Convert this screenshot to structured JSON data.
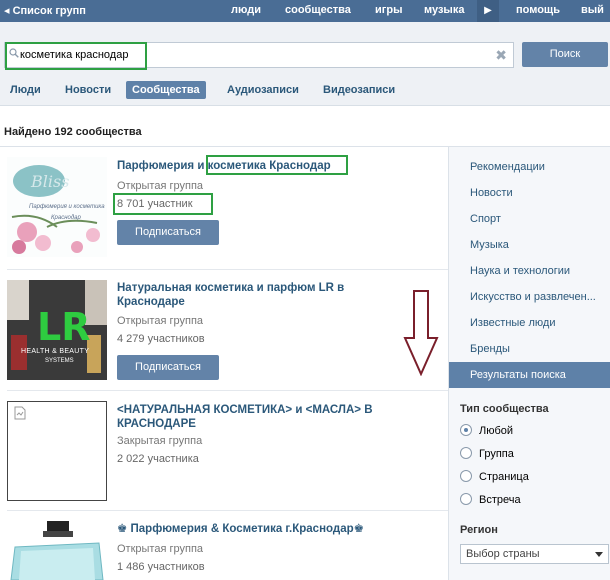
{
  "topbar": {
    "back_label": "◂ Список групп",
    "nav": [
      "люди",
      "сообщества",
      "игры",
      "музыка",
      "помощь",
      "вый"
    ]
  },
  "search": {
    "query": "косметика краснодар",
    "button_label": "Поиск"
  },
  "tabs": [
    "Люди",
    "Новости",
    "Сообщества",
    "Аудиозаписи",
    "Видеозаписи"
  ],
  "active_tab": "Сообщества",
  "results": {
    "found_label": "Найдено 192 сообщества",
    "items": [
      {
        "title_a": "Парфюмерия и ",
        "title_b": "косметика Краснодар",
        "type": "Открытая группа",
        "members": "8 701 участник",
        "button": "Подписаться",
        "thumb_text": "Парфюмерия и косметика",
        "thumb_subtext": "Краснодар"
      },
      {
        "title": "Натуральная косметика и парфюм LR в Краснодаре",
        "type": "Открытая группа",
        "members": "4 279 участников",
        "button": "Подписаться",
        "thumb_logo": "LR",
        "thumb_text": "HEALTH & BEAUTY",
        "thumb_subtext": "SYSTEMS"
      },
      {
        "title": "<НАТУРАЛЬНАЯ КОСМЕТИКА> и <МАСЛА> В КРАСНОДАРЕ",
        "type": "Закрытая группа",
        "members": "2 022 участника"
      },
      {
        "title": "♚ Парфюмерия & Косметика г.Краснодар♚",
        "type": "Открытая группа",
        "members": "1 486 участников"
      }
    ]
  },
  "sidebar": {
    "categories": [
      "Рекомендации",
      "Новости",
      "Спорт",
      "Музыка",
      "Наука и технологии",
      "Искусство и развлечен...",
      "Известные люди",
      "Бренды",
      "Результаты поиска"
    ],
    "active_category": "Результаты поиска",
    "type_heading": "Тип сообщества",
    "type_options": [
      "Любой",
      "Группа",
      "Страница",
      "Встреча"
    ],
    "selected_type": "Любой",
    "region_heading": "Регион",
    "region_select": "Выбор страны"
  },
  "colors": {
    "header": "#4a6d95",
    "accent": "#5e81a8",
    "link": "#2b587a",
    "highlight": "#2ea043",
    "annotation_arrow": "#7a1f2b"
  }
}
